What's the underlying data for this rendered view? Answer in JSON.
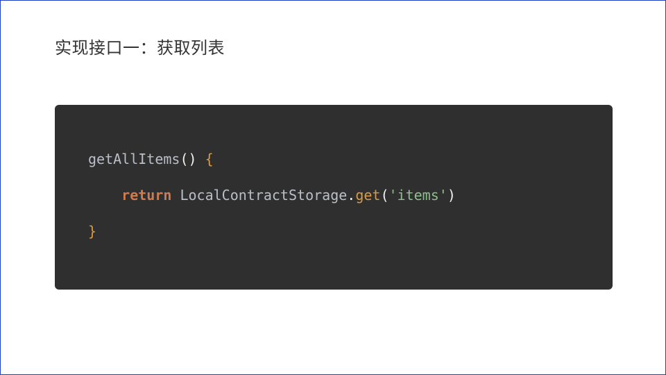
{
  "title": "实现接口一：获取列表",
  "code": {
    "line1": {
      "method": "getAllItems",
      "parens": "()",
      "space": " ",
      "brace_open": "{"
    },
    "line2": {
      "indent": "    ",
      "keyword": "return",
      "space1": " ",
      "ident": "LocalContractStorage",
      "dot": ".",
      "call": "get",
      "paren_open": "(",
      "string": "'items'",
      "paren_close": ")"
    },
    "line3": {
      "brace_close": "}"
    }
  }
}
